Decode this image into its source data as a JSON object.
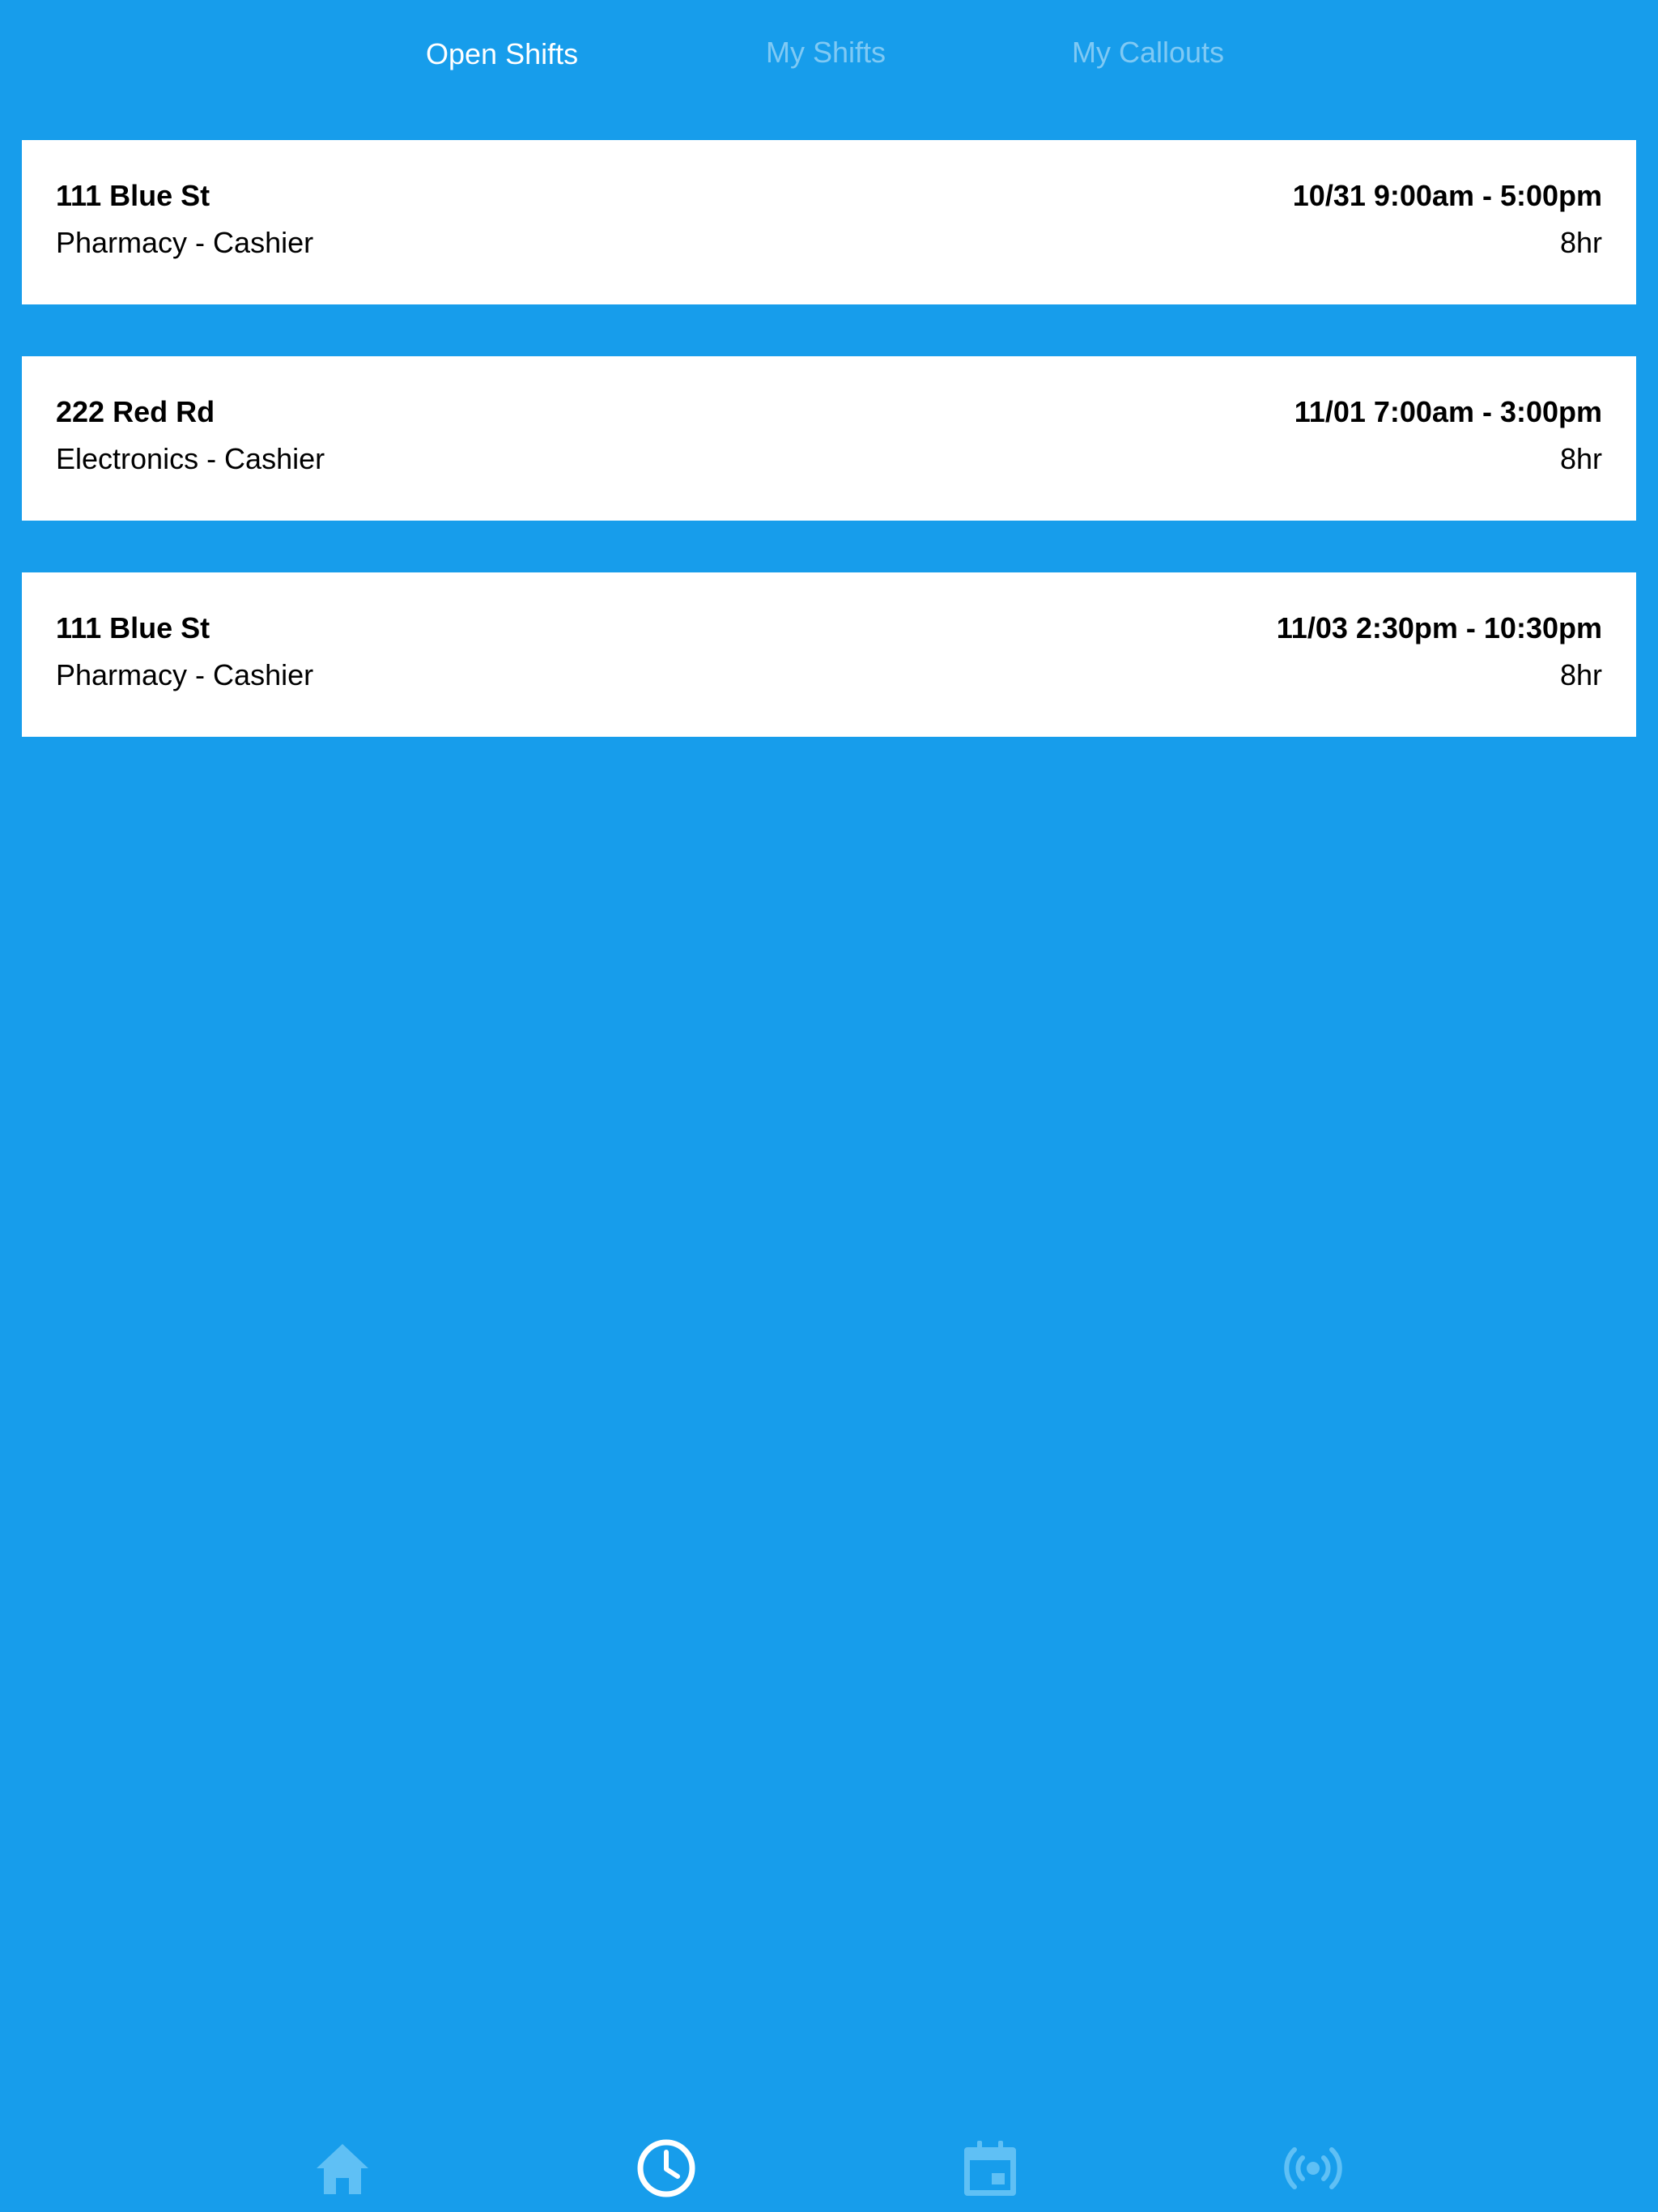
{
  "tabs": [
    {
      "label": "Open Shifts",
      "active": true
    },
    {
      "label": "My Shifts",
      "active": false
    },
    {
      "label": "My Callouts",
      "active": false
    }
  ],
  "shifts": [
    {
      "location": "111 Blue St",
      "role": "Pharmacy - Cashier",
      "when": "10/31 9:00am - 5:00pm",
      "hours": "8hr"
    },
    {
      "location": "222 Red Rd",
      "role": "Electronics - Cashier",
      "when": "11/01 7:00am - 3:00pm",
      "hours": "8hr"
    },
    {
      "location": "111 Blue St",
      "role": "Pharmacy - Cashier",
      "when": "11/03 2:30pm - 10:30pm",
      "hours": "8hr"
    }
  ],
  "bottom_nav": [
    {
      "icon": "home-icon",
      "active": false
    },
    {
      "icon": "clock-icon",
      "active": true
    },
    {
      "icon": "calendar-icon",
      "active": false
    },
    {
      "icon": "broadcast-icon",
      "active": false
    }
  ],
  "colors": {
    "background": "#179deb",
    "card": "#ffffff",
    "nav_inactive": "#5fc0f5",
    "nav_active": "#ffffff"
  }
}
